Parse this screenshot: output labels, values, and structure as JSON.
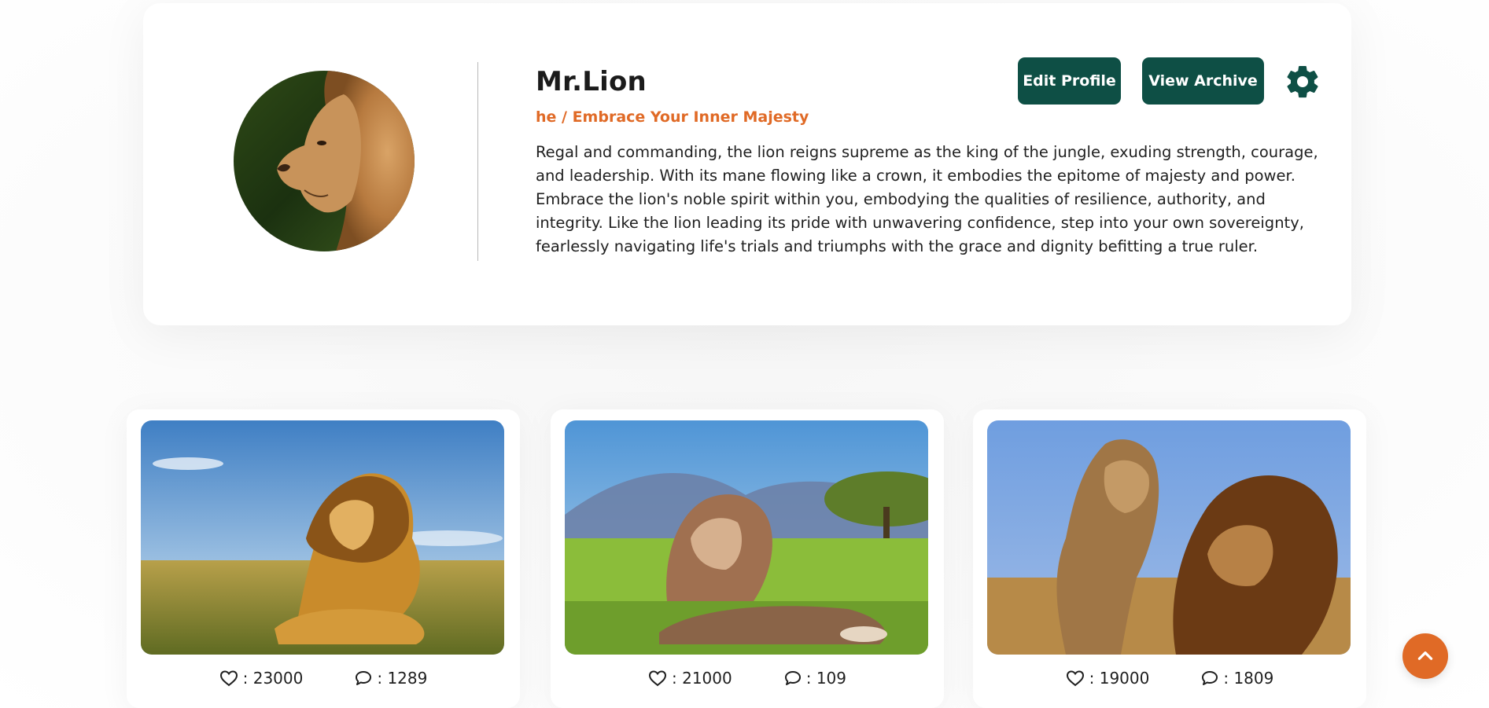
{
  "profile": {
    "name": "Mr.Lion",
    "tagline": "he / Embrace Your Inner Majesty",
    "bio": "Regal and commanding, the lion reigns supreme as the king of the jungle, exuding strength, courage, and leadership. With its mane flowing like a crown, it embodies the epitome of majesty and power. Embrace the lion's noble spirit within you, embodying the qualities of resilience, authority, and integrity. Like the lion leading its pride with unwavering confidence, step into your own sovereignty, fearlessly navigating life's trials and triumphs with the grace and dignity befitting a true ruler.",
    "avatar_icon": "lion-profile-photo"
  },
  "actions": {
    "edit_label": "Edit Profile",
    "archive_label": "View Archive",
    "settings_icon": "gear-icon"
  },
  "posts": [
    {
      "image": "lion-lying-in-grass",
      "likes": ": 23000",
      "comments": ": 1289"
    },
    {
      "image": "lion-resting-savanna",
      "likes": ": 21000",
      "comments": ": 109"
    },
    {
      "image": "lioness-and-lion-walking",
      "likes": ": 19000",
      "comments": ": 1809"
    }
  ],
  "icons": {
    "like": "heart-icon",
    "comment": "comment-icon",
    "scroll_top": "chevron-up-icon"
  },
  "colors": {
    "primary": "#0e4f45",
    "accent": "#e06a26"
  }
}
